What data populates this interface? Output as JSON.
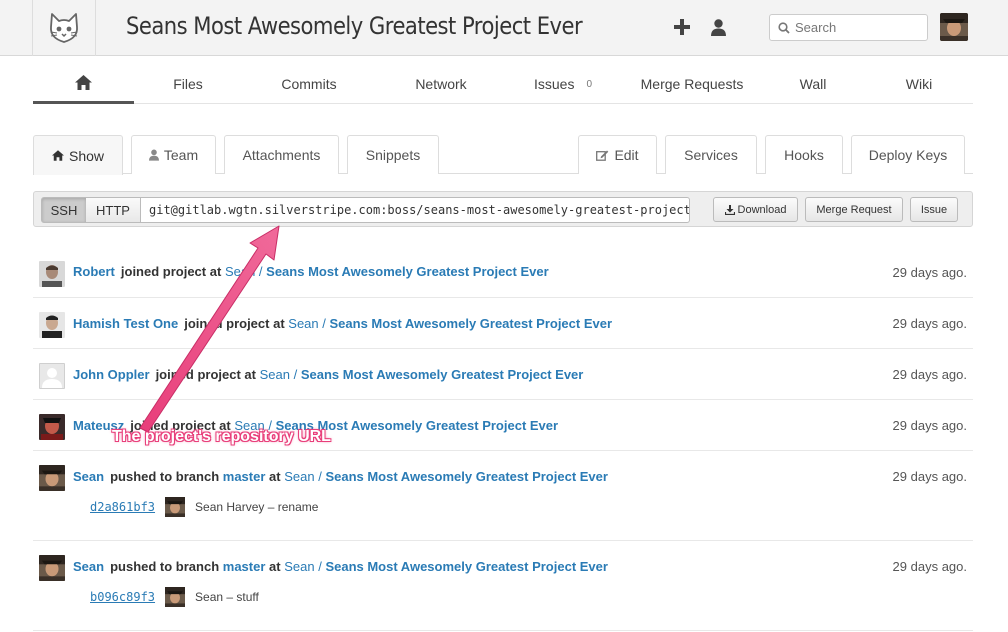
{
  "header": {
    "title": "Seans Most Awesomely Greatest Project Ever",
    "search_placeholder": "Search"
  },
  "main_nav": {
    "items": [
      {
        "label": "",
        "icon": "home-icon"
      },
      {
        "label": "Files"
      },
      {
        "label": "Commits"
      },
      {
        "label": "Network"
      },
      {
        "label": "Issues",
        "count": "0"
      },
      {
        "label": "Merge Requests"
      },
      {
        "label": "Wall"
      },
      {
        "label": "Wiki"
      }
    ]
  },
  "tabs": {
    "left": [
      "Show",
      "Team",
      "Attachments",
      "Snippets"
    ],
    "right": [
      "Edit",
      "Services",
      "Hooks",
      "Deploy Keys"
    ]
  },
  "clone": {
    "ssh_label": "SSH",
    "http_label": "HTTP",
    "url": "git@gitlab.wgtn.silverstripe.com:boss/seans-most-awesomely-greatest-project-ever.git",
    "download_label": "Download",
    "merge_request_label": "Merge Request",
    "issue_label": "Issue"
  },
  "events": [
    {
      "author": "Robert",
      "action": "joined project",
      "at": "at",
      "namespace": "Sean",
      "separator": " / ",
      "project": "Seans Most Awesomely Greatest Project Ever",
      "time": "29 days ago."
    },
    {
      "author": "Hamish Test One",
      "action": "joined project",
      "at": "at",
      "namespace": "Sean",
      "separator": " / ",
      "project": "Seans Most Awesomely Greatest Project Ever",
      "time": "29 days ago."
    },
    {
      "author": "John Oppler",
      "action": "joined project",
      "at": "at",
      "namespace": "Sean",
      "separator": " / ",
      "project": "Seans Most Awesomely Greatest Project Ever",
      "time": "29 days ago."
    },
    {
      "author": "Mateusz",
      "action": "joined project",
      "at": "at",
      "namespace": "Sean",
      "separator": " / ",
      "project": "Seans Most Awesomely Greatest Project Ever",
      "time": "29 days ago."
    },
    {
      "author": "Sean",
      "action": "pushed to branch",
      "branch": "master",
      "at": "at",
      "namespace": "Sean",
      "separator": " / ",
      "project": "Seans Most Awesomely Greatest Project Ever",
      "time": "29 days ago.",
      "commit_sha": "d2a861bf3",
      "commit_message": "Sean Harvey – rename"
    },
    {
      "author": "Sean",
      "action": "pushed to branch",
      "branch": "master",
      "at": "at",
      "namespace": "Sean",
      "separator": " / ",
      "project": "Seans Most Awesomely Greatest Project Ever",
      "time": "29 days ago.",
      "commit_sha": "b096c89f3",
      "commit_message": "Sean – stuff"
    }
  ],
  "annotation": {
    "text": "The project's repository URL",
    "color": "#e83e7a"
  },
  "colors": {
    "link": "#2a7bb5",
    "header_bg": "#f3f3f3"
  }
}
